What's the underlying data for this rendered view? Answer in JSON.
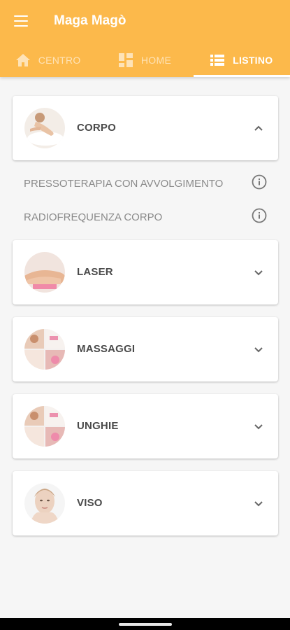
{
  "appbar": {
    "title": "Maga Magò",
    "color": "#fcb94b"
  },
  "tabs": [
    {
      "label": "CENTRO",
      "icon": "home-icon",
      "active": false
    },
    {
      "label": "HOME",
      "icon": "grid-icon",
      "active": false
    },
    {
      "label": "LISTINO",
      "icon": "list-icon",
      "active": true
    }
  ],
  "categories": [
    {
      "title": "CORPO",
      "expanded": true,
      "chevron": "chevron-up-icon",
      "items": [
        {
          "label": "PRESSOTERAPIA CON AVVOLGIMENTO"
        },
        {
          "label": "RADIOFREQUENZA CORPO"
        }
      ]
    },
    {
      "title": "LASER",
      "expanded": false,
      "chevron": "chevron-down-icon"
    },
    {
      "title": "MASSAGGI",
      "expanded": false,
      "chevron": "chevron-down-icon"
    },
    {
      "title": "UNGHIE",
      "expanded": false,
      "chevron": "chevron-down-icon"
    },
    {
      "title": "VISO",
      "expanded": false,
      "chevron": "chevron-down-icon"
    }
  ]
}
